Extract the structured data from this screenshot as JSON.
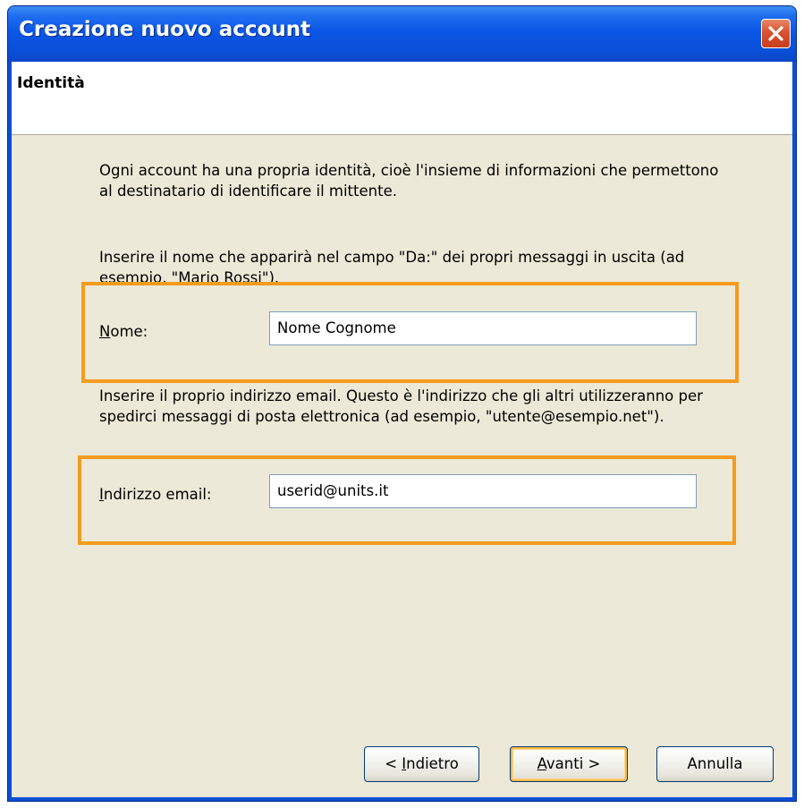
{
  "window": {
    "title": "Creazione nuovo account"
  },
  "header": {
    "title": "Identità"
  },
  "intro_text": "Ogni account ha una propria identità, cioè l'insieme di informazioni che permettono al destinatario di identificare il mittente.",
  "name_section": {
    "instruction": "Inserire il nome che apparirà nel campo \"Da:\" dei propri messaggi in uscita (ad esempio, \"Mario Rossi\").",
    "label_accel": "N",
    "label_rest": "ome:",
    "value": "Nome Cognome"
  },
  "email_section": {
    "instruction": "Inserire il proprio indirizzo email. Questo è l'indirizzo che gli altri utilizzeranno per spedirci messaggi di posta elettronica (ad esempio, \"utente@esempio.net\").",
    "label_accel": "I",
    "label_rest": "ndirizzo email:",
    "value": "userid@units.it"
  },
  "buttons": {
    "back_prefix": "< ",
    "back_accel": "I",
    "back_rest": "ndietro",
    "next_accel": "A",
    "next_rest": "vanti >",
    "cancel": "Annulla"
  },
  "colors": {
    "titlebar": "#0a4fd6",
    "dialog_bg": "#ece9d8",
    "highlight": "#f59c1e",
    "close_button": "#d8522f"
  },
  "icons": {
    "close": "close-icon"
  }
}
